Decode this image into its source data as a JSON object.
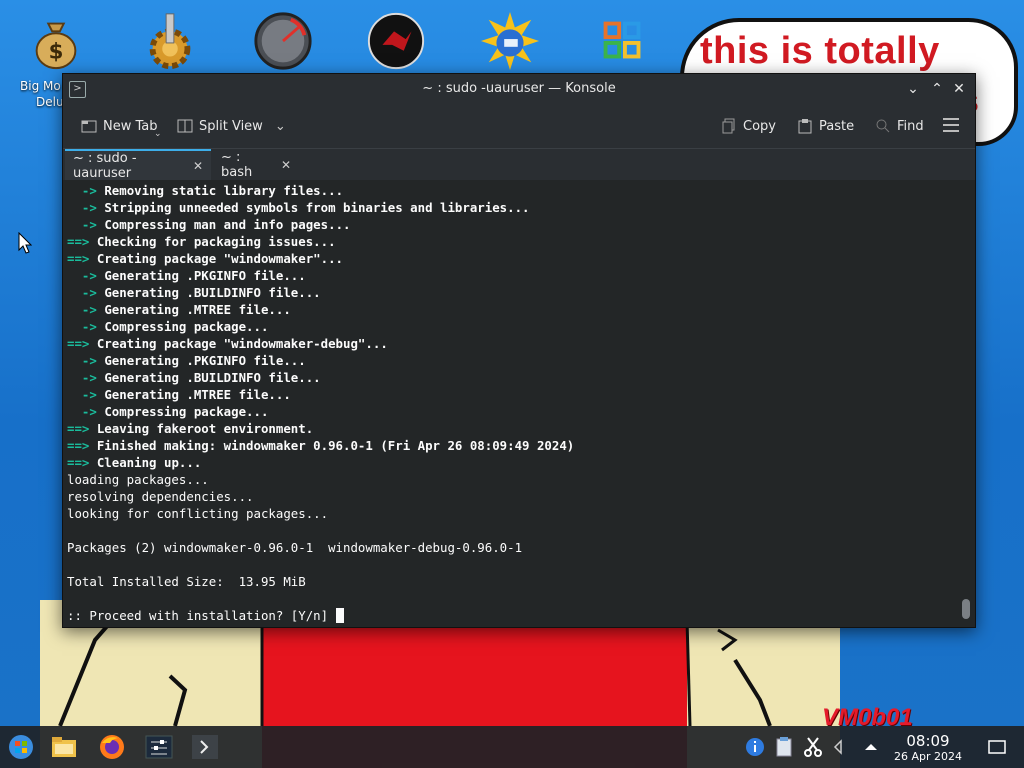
{
  "wallpaper": {
    "cloud_text": "this is totally",
    "cloud_fragment": "s",
    "signature": "VM0b01"
  },
  "desktop": {
    "icons": [
      {
        "name": "money-bag-icon"
      },
      {
        "name": "gear-icon"
      },
      {
        "name": "speedometer-icon"
      },
      {
        "name": "red-emblem-icon"
      },
      {
        "name": "sun-globe-icon"
      },
      {
        "name": "office-grid-icon"
      }
    ],
    "partial_label_line1": "Big Mo",
    "partial_label_line2": "Delu"
  },
  "window": {
    "title": "~ : sudo -uauruser — Konsole",
    "toolbar": {
      "new_tab": "New Tab",
      "split_view": "Split View",
      "copy": "Copy",
      "paste": "Paste",
      "find": "Find"
    },
    "tabs": [
      {
        "label": "~ : sudo -uauruser",
        "active": true
      },
      {
        "label": "~ : bash",
        "active": false
      }
    ]
  },
  "terminal": {
    "lines": [
      {
        "prefix": "  -> ",
        "text": "Removing static library files...",
        "bold": true
      },
      {
        "prefix": "  -> ",
        "text": "Stripping unneeded symbols from binaries and libraries...",
        "bold": true
      },
      {
        "prefix": "  -> ",
        "text": "Compressing man and info pages...",
        "bold": true
      },
      {
        "prefix": "==> ",
        "text": "Checking for packaging issues...",
        "bold": true
      },
      {
        "prefix": "==> ",
        "text": "Creating package \"windowmaker\"...",
        "bold": true
      },
      {
        "prefix": "  -> ",
        "text": "Generating .PKGINFO file...",
        "bold": true
      },
      {
        "prefix": "  -> ",
        "text": "Generating .BUILDINFO file...",
        "bold": true
      },
      {
        "prefix": "  -> ",
        "text": "Generating .MTREE file...",
        "bold": true
      },
      {
        "prefix": "  -> ",
        "text": "Compressing package...",
        "bold": true
      },
      {
        "prefix": "==> ",
        "text": "Creating package \"windowmaker-debug\"...",
        "bold": true
      },
      {
        "prefix": "  -> ",
        "text": "Generating .PKGINFO file...",
        "bold": true
      },
      {
        "prefix": "  -> ",
        "text": "Generating .BUILDINFO file...",
        "bold": true
      },
      {
        "prefix": "  -> ",
        "text": "Generating .MTREE file...",
        "bold": true
      },
      {
        "prefix": "  -> ",
        "text": "Compressing package...",
        "bold": true
      },
      {
        "prefix": "==> ",
        "text": "Leaving fakeroot environment.",
        "bold": true
      },
      {
        "prefix": "==> ",
        "text": "Finished making: windowmaker 0.96.0-1 (Fri Apr 26 08:09:49 2024)",
        "bold": true
      },
      {
        "prefix": "==> ",
        "text": "Cleaning up...",
        "bold": true
      },
      {
        "prefix": "",
        "text": "loading packages...",
        "bold": false
      },
      {
        "prefix": "",
        "text": "resolving dependencies...",
        "bold": false
      },
      {
        "prefix": "",
        "text": "looking for conflicting packages...",
        "bold": false
      },
      {
        "prefix": "",
        "text": "",
        "bold": false
      },
      {
        "prefix": "",
        "text": "Packages (2) windowmaker-0.96.0-1  windowmaker-debug-0.96.0-1",
        "bold": false
      },
      {
        "prefix": "",
        "text": "",
        "bold": false
      },
      {
        "prefix": "",
        "text": "Total Installed Size:  13.95 MiB",
        "bold": false
      },
      {
        "prefix": "",
        "text": "",
        "bold": false
      },
      {
        "prefix": "",
        "text": ":: Proceed with installation? [Y/n] ",
        "bold": false,
        "cursor": true
      }
    ],
    "colors": {
      "arrow": "#1abc9c",
      "text": "#fcfcfc",
      "background": "#232627"
    }
  },
  "taskbar": {
    "launchers": [
      {
        "name": "start-menu-icon"
      },
      {
        "name": "file-manager-icon"
      },
      {
        "name": "firefox-icon"
      },
      {
        "name": "settings-mixer-icon"
      },
      {
        "name": "konsole-icon"
      }
    ],
    "tray": [
      {
        "name": "info-icon"
      },
      {
        "name": "clipboard-icon"
      },
      {
        "name": "scissors-icon"
      },
      {
        "name": "volume-icon"
      },
      {
        "name": "tray-expand-icon"
      }
    ],
    "clock_time": "08:09",
    "clock_date": "26 Apr 2024"
  }
}
